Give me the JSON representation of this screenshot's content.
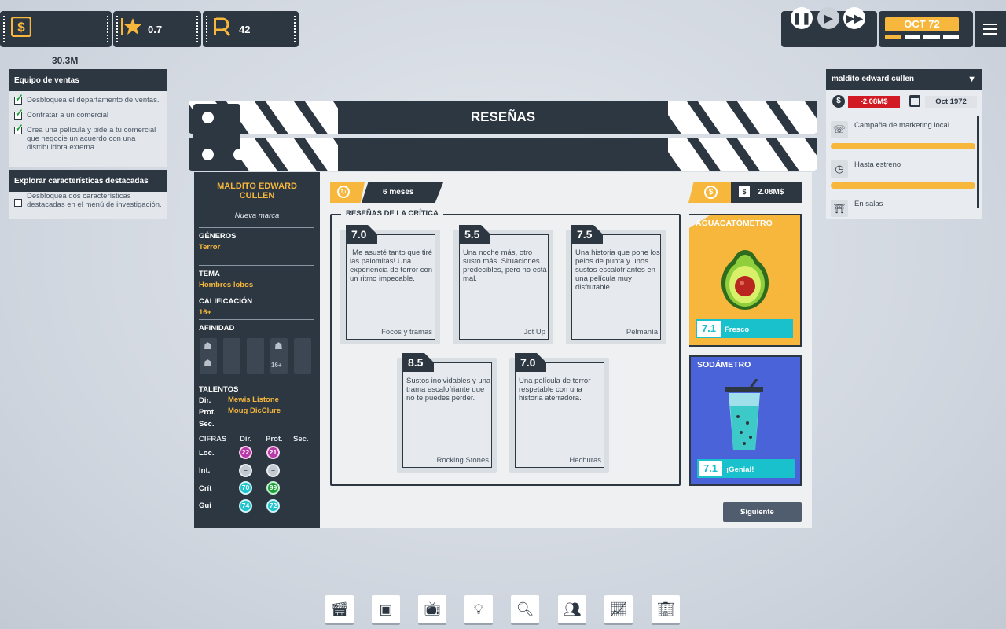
{
  "hud": {
    "money_icon": "dollar-coin-icon",
    "money_value": "30.3M",
    "rating_icon": "star-icon",
    "rating_value": "0.7",
    "points_icon": "research-icon",
    "points_value": "42",
    "date": "OCT 72",
    "week_progress": 0.25
  },
  "objectives": [
    {
      "title": "Equipo de ventas",
      "items": [
        {
          "text": "Desbloquea el departamento de ventas.",
          "done": true
        },
        {
          "text": "Contratar a un comercial",
          "done": true
        },
        {
          "text": "Crea una película y pide a tu comercial que negocie un acuerdo con una distribuidora externa.",
          "done": true
        }
      ]
    },
    {
      "title": "Explorar características destacadas",
      "items": [
        {
          "text": "Desbloquea dos características destacadas en el menú de investigación.",
          "done": false
        }
      ]
    }
  ],
  "project": {
    "title": "maldito edward cullen",
    "cost": "-2.08M$",
    "date": "Oct 1972",
    "steps": [
      {
        "label": "Campaña de marketing local",
        "progress": 1
      },
      {
        "label": "Hasta estreno",
        "progress": 1
      },
      {
        "label": "En salas",
        "progress": 0
      }
    ]
  },
  "dialog": {
    "title": "RESEÑAS",
    "duration": "6 meses",
    "cost_symbol": "$",
    "cost": "2.08M$",
    "critics_label": "RESEÑAS DE LA CRÍTICA",
    "next_label": "Siguiente"
  },
  "movie": {
    "title_line1": "MALDITO EDWARD",
    "title_line2": "CULLEN",
    "brand": "Nueva marca",
    "genres_label": "GÉNEROS",
    "genre": "Terror",
    "theme_label": "TEMA",
    "theme": "Hombres lobos",
    "rating_label": "CALIFICACIÓN",
    "rating": "16+",
    "affinity_label": "AFINIDAD",
    "affinity_badge": "16+",
    "talents_label": "TALENTOS",
    "talents": [
      {
        "role": "Dir.",
        "name": "Mewis Listone"
      },
      {
        "role": "Prot.",
        "name": "Moug DicClure"
      },
      {
        "role": "Sec.",
        "name": ""
      }
    ],
    "figures_label": "CIFRAS",
    "figures_cols": [
      "Dir.",
      "Prot.",
      "Sec."
    ],
    "figures": [
      {
        "row": "Loc.",
        "dir": "22",
        "prot": "21"
      },
      {
        "row": "Int.",
        "dir": "–",
        "prot": "–"
      },
      {
        "row": "Crít",
        "dir": "70",
        "prot": "99"
      },
      {
        "row": "Gui",
        "dir": "74",
        "prot": "72"
      }
    ]
  },
  "reviews": [
    {
      "score": "7.0",
      "text": "¡Me asusté tanto que tiré las palomitas! Una experiencia de terror con un ritmo impecable.",
      "source": "Focos y tramas"
    },
    {
      "score": "5.5",
      "text": "Una noche más, otro susto más. Situaciones predecibles, pero no está mal.",
      "source": "Jot Up"
    },
    {
      "score": "7.5",
      "text": "Una historia que pone los pelos de punta y unos sustos escalofriantes en una película muy disfrutable.",
      "source": "Pelmanía"
    },
    {
      "score": "8.5",
      "text": "Sustos inolvidables y una trama escalofriante que no te puedes perder.",
      "source": "Rocking Stones"
    },
    {
      "score": "7.0",
      "text": "Una película de terror respetable con una historia aterradora.",
      "source": "Hechuras"
    }
  ],
  "meters": {
    "avocado": {
      "name": "AGUACATÓMETRO",
      "score": "7.1",
      "verdict": "Fresco",
      "color": "#f6b73c"
    },
    "soda": {
      "name": "SODÁMETRO",
      "score": "7.1",
      "verdict": "¡Genial!",
      "color": "#4b63d9"
    }
  },
  "toolbar": [
    "film-production-icon",
    "folder-icon",
    "tv-icon",
    "idea-bulb-icon",
    "search-icon",
    "staff-icon",
    "stats-chart-icon",
    "building-icon"
  ]
}
